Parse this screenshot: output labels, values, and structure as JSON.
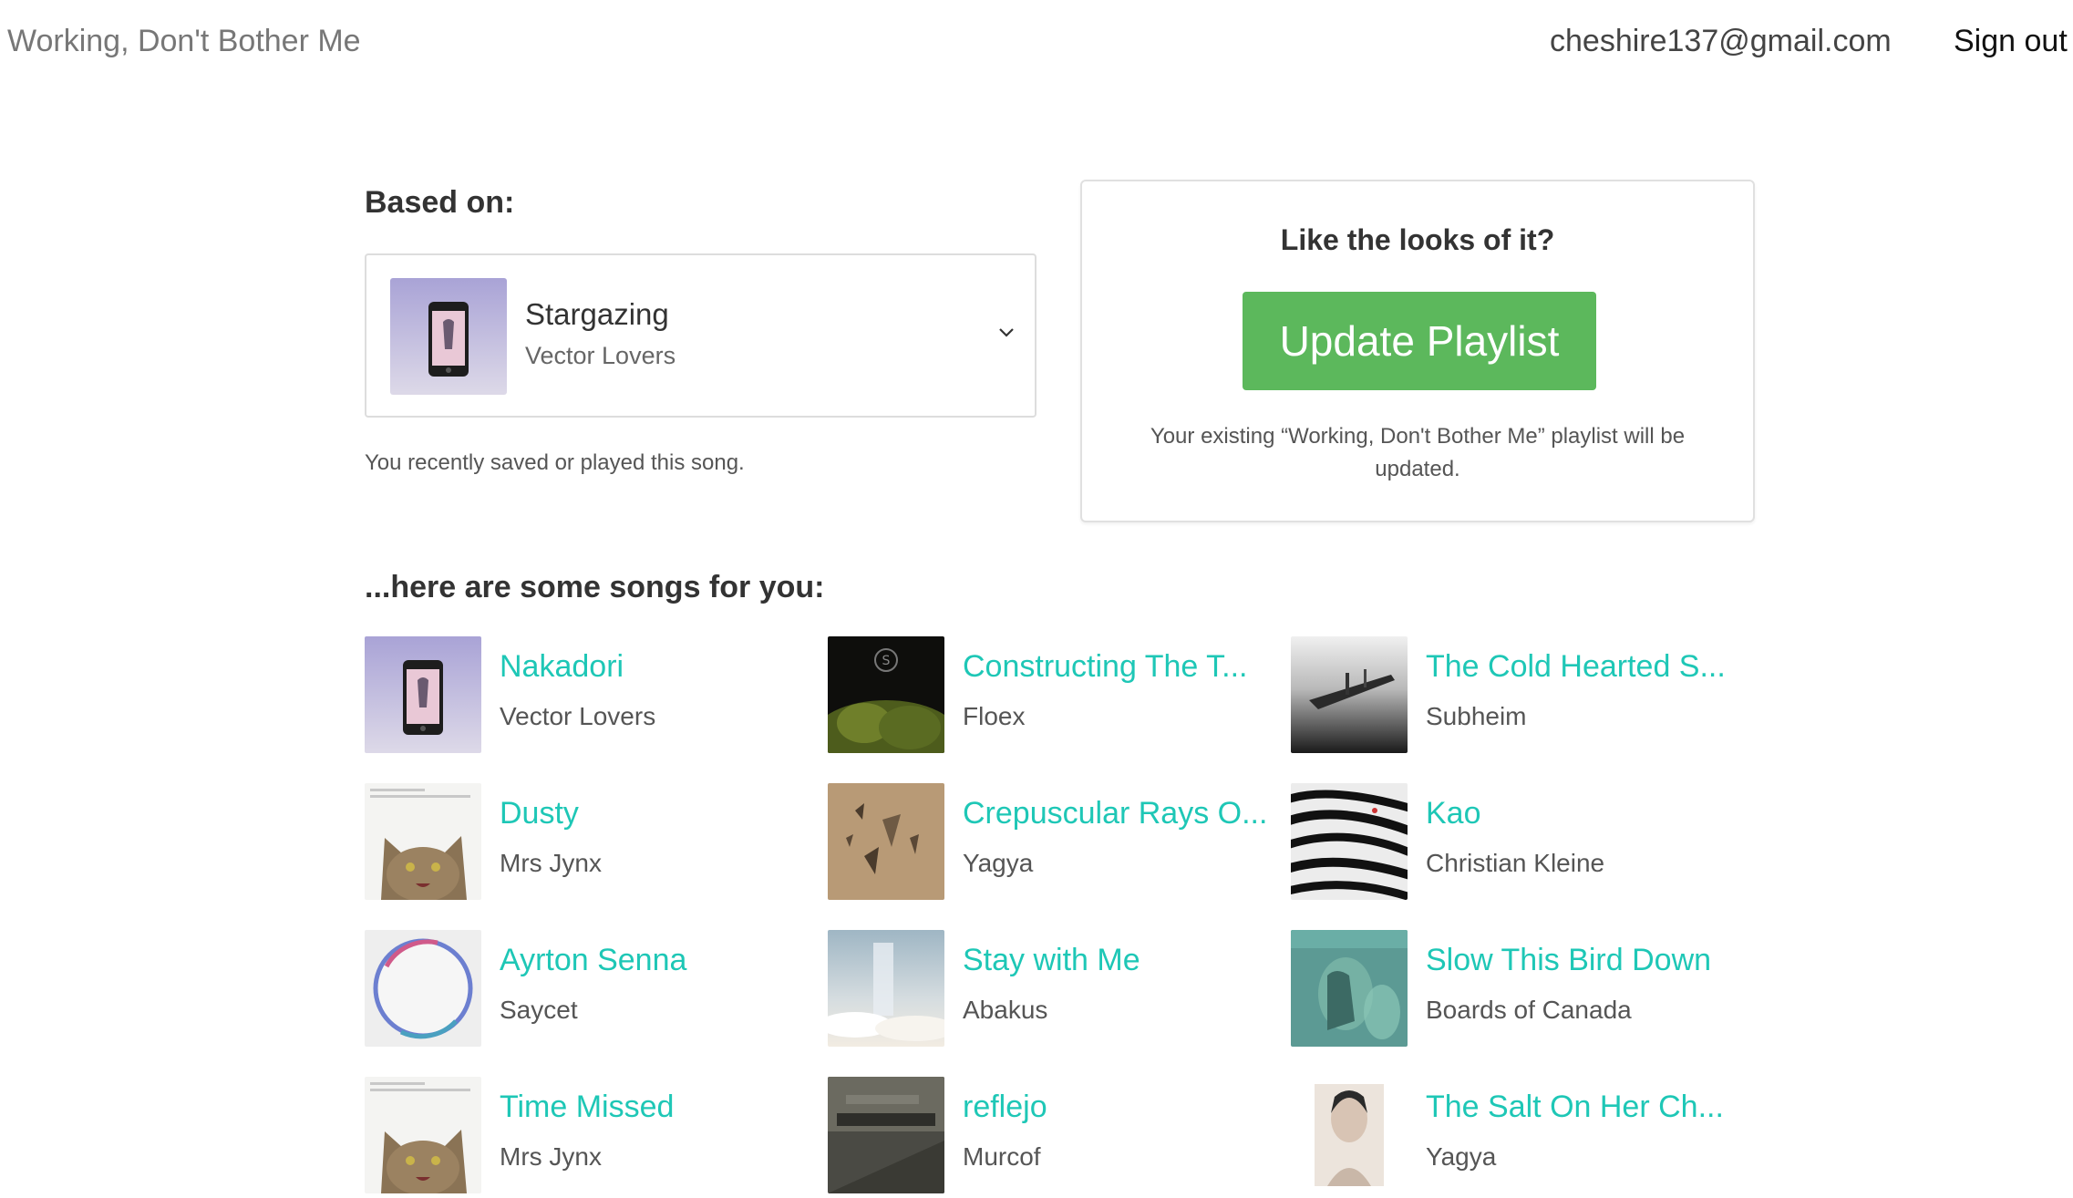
{
  "header": {
    "app_title": "Working, Don't Bother Me",
    "user_email": "cheshire137@gmail.com",
    "sign_out": "Sign out"
  },
  "based_on": {
    "label": "Based on:",
    "selected_title": "Stargazing",
    "selected_artist": "Vector Lovers",
    "note": "You recently saved or played this song."
  },
  "update_card": {
    "heading": "Like the looks of it?",
    "button_label": "Update Playlist",
    "note": "Your existing “Working, Don't Bother Me” playlist will be updated.",
    "button_color": "#5cb85c"
  },
  "songs_section": {
    "label": "...here are some songs for you:",
    "songs": [
      {
        "title": "Nakadori",
        "artist": "Vector Lovers",
        "art": "phone-album-art"
      },
      {
        "title": "Constructing The T...",
        "artist": "Floex",
        "art": "forest-album-art"
      },
      {
        "title": "The Cold Hearted S...",
        "artist": "Subheim",
        "art": "pier-album-art"
      },
      {
        "title": "Dusty",
        "artist": "Mrs Jynx",
        "art": "cat-album-art"
      },
      {
        "title": "Crepuscular Rays O...",
        "artist": "Yagya",
        "art": "shards-album-art"
      },
      {
        "title": "Kao",
        "artist": "Christian Kleine",
        "art": "zebra-album-art"
      },
      {
        "title": "Ayrton Senna",
        "artist": "Saycet",
        "art": "ring-album-art"
      },
      {
        "title": "Stay with Me",
        "artist": "Abakus",
        "art": "clouds-album-art"
      },
      {
        "title": "Slow This Bird Down",
        "artist": "Boards of Canada",
        "art": "boc-album-art"
      },
      {
        "title": "Time Missed",
        "artist": "Mrs Jynx",
        "art": "cat-album-art"
      },
      {
        "title": "reflejo",
        "artist": "Murcof",
        "art": "piano-album-art"
      },
      {
        "title": "The Salt On Her Ch...",
        "artist": "Yagya",
        "art": "portrait-album-art"
      }
    ]
  },
  "colors": {
    "link": "#1ec7b6",
    "accent_green": "#5cb85c"
  }
}
